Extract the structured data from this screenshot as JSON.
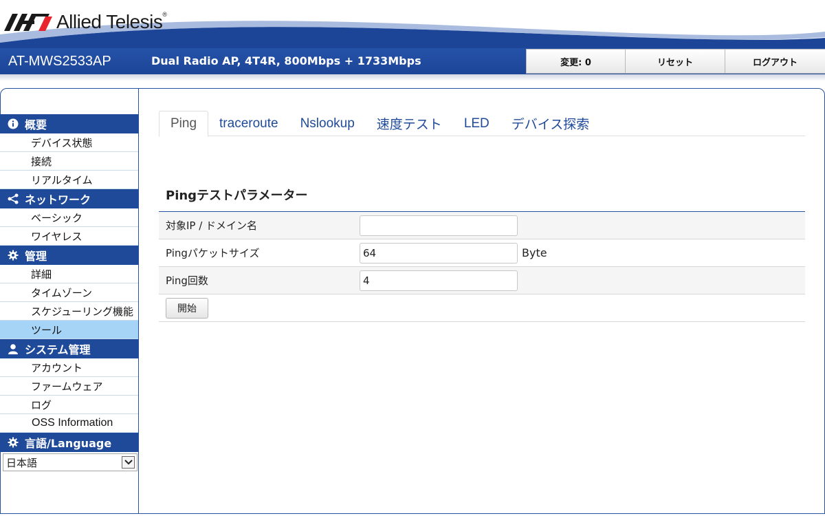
{
  "brand": {
    "name": "Allied Telesis",
    "tm": "®"
  },
  "header": {
    "model": "AT-MWS2533AP",
    "description": "Dual Radio AP, 4T4R, 800Mbps + 1733Mbps",
    "buttons": {
      "changes": "変更: 0",
      "reset": "リセット",
      "logout": "ログアウト"
    }
  },
  "sidebar": {
    "overview": {
      "title": "概要",
      "items": [
        "デバイス状態",
        "接続",
        "リアルタイム"
      ]
    },
    "network": {
      "title": "ネットワーク",
      "items": [
        "ベーシック",
        "ワイヤレス"
      ]
    },
    "management": {
      "title": "管理",
      "items": [
        "詳細",
        "タイムゾーン",
        "スケジューリング機能",
        "ツール"
      ]
    },
    "system": {
      "title": "システム管理",
      "items": [
        "アカウント",
        "ファームウェア",
        "ログ",
        "OSS Information"
      ]
    },
    "language": {
      "title": "言語/Language",
      "selected": "日本語"
    }
  },
  "tabs": [
    "Ping",
    "traceroute",
    "Nslookup",
    "速度テスト",
    "LED",
    "デバイス探索"
  ],
  "form": {
    "title": "Pingテストパラメーター",
    "target_label": "対象IP / ドメイン名",
    "target_value": "",
    "size_label": "Pingパケットサイズ",
    "size_value": "64",
    "size_unit": "Byte",
    "count_label": "Ping回数",
    "count_value": "4",
    "start_label": "開始"
  },
  "colors": {
    "nav_blue": "#1f4a9a",
    "active_item": "#a6d4f7",
    "tab_text": "#1f4a9a"
  }
}
